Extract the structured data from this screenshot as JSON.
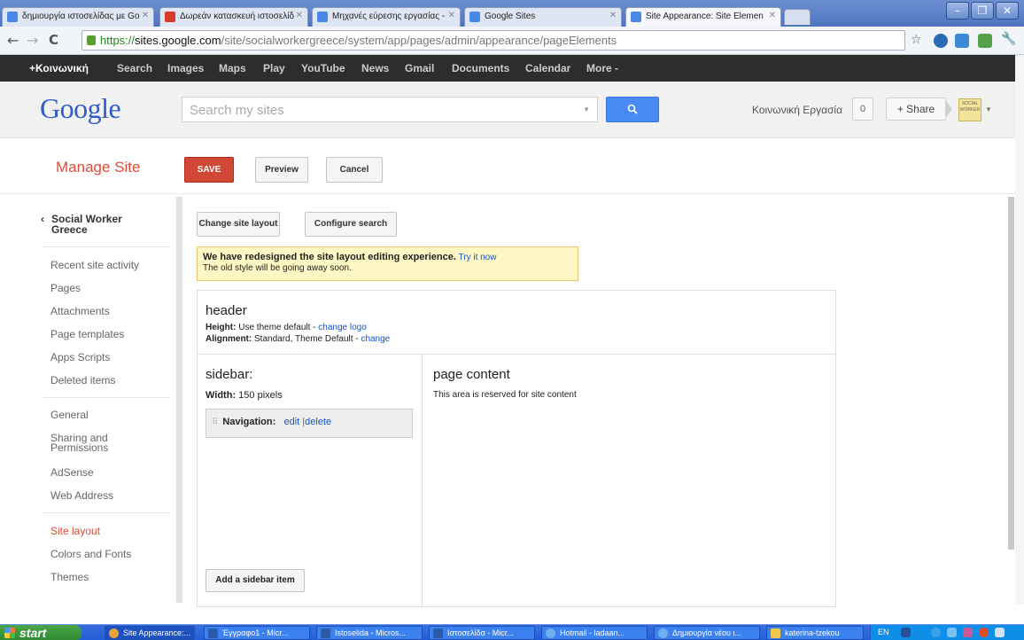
{
  "browser": {
    "tabs": [
      {
        "label": "δημιουργία ιστοσελίδας με Go",
        "favicon_color": "#4a88e8"
      },
      {
        "label": "Δωρεάν κατασκευή ιστοσελίδ",
        "favicon_color": "#d83a2a"
      },
      {
        "label": "Μηχανές εύρεσης εργασίας - ",
        "favicon_color": "#4a88e8"
      },
      {
        "label": "Google Sites",
        "favicon_color": "#4a88e8"
      },
      {
        "label": "Site Appearance: Site Elemen",
        "favicon_color": "#4a88e8"
      }
    ],
    "url": {
      "scheme": "https://",
      "domain": "sites.google.com",
      "path": "/site/socialworkergreece/system/app/pages/admin/appearance/pageElements"
    }
  },
  "gbar": {
    "items": [
      "+Κοινωνική",
      "Search",
      "Images",
      "Maps",
      "Play",
      "YouTube",
      "News",
      "Gmail",
      "Documents",
      "Calendar",
      "More -"
    ]
  },
  "header": {
    "logo_text": "Google",
    "search_placeholder": "Search my sites",
    "search_icon": "magnifier-icon",
    "user_name": "Κοινωνική Εργασία",
    "notification_count": "0",
    "share_label": "+ Share",
    "avatar_text": "SOCIAL WORKER"
  },
  "manage": {
    "title": "Manage Site",
    "save_label": "SAVE",
    "preview_label": "Preview",
    "cancel_label": "Cancel"
  },
  "sidebar": {
    "site_name": "Social Worker Greece",
    "group1": [
      "Recent site activity",
      "Pages",
      "Attachments",
      "Page templates",
      "Apps Scripts",
      "Deleted items"
    ],
    "group2": [
      "General",
      "Sharing and Permissions",
      "AdSense",
      "Web Address"
    ],
    "group3": [
      "Site layout",
      "Colors and Fonts",
      "Themes"
    ],
    "active_item": "Site layout"
  },
  "content": {
    "change_layout_label": "Change site layout",
    "configure_search_label": "Configure search",
    "notice": {
      "bold_text": "We have redesigned the site layout editing experience.",
      "link_text": "Try it now",
      "subtext": "The old style will be going away soon."
    },
    "header_area": {
      "title": "header",
      "height_label": "Height:",
      "height_value": "Use theme default - ",
      "height_link": "change logo",
      "alignment_label": "Alignment:",
      "alignment_value": "Standard, Theme Default - ",
      "alignment_link": "change"
    },
    "sidebar_area": {
      "title": "sidebar:",
      "width_label": "Width:",
      "width_value": "150 pixels",
      "widget_label": "Navigation:",
      "edit_link": "edit",
      "separator": "|",
      "delete_link": "delete",
      "add_item_label": "Add a sidebar item"
    },
    "content_area": {
      "title": "page content",
      "text": "This area is reserved for site content"
    }
  },
  "taskbar": {
    "start_label": "start",
    "tasks": [
      "Site Appearance:...",
      "Έγγραφο1 - Micr...",
      "Istoselida - Micros...",
      "Ιστοσελίδα - Micr...",
      "Hotmail - ladaan...",
      "Δημιουργία νέου ι...",
      "katerina-tzekou"
    ],
    "tray_lang": "EN"
  }
}
